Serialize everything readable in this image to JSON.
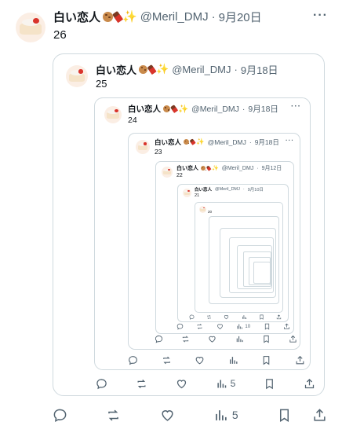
{
  "author": {
    "display_name": "白い恋人",
    "handle": "@Meril_DMJ",
    "emoji_icons": [
      "cookie-icon",
      "chocolate-icon",
      "sparkles-icon"
    ]
  },
  "main_post": {
    "date": "9月20日",
    "text": "26",
    "views": "5"
  },
  "quote_1": {
    "date": "9月18日",
    "text": "25",
    "views": "5"
  },
  "quote_2": {
    "date": "9月18日",
    "text": "24"
  },
  "quote_3": {
    "date": "9月18日",
    "text": "23"
  },
  "quote_4": {
    "date": "9月12日",
    "text": "22",
    "views": "10"
  },
  "quote_5": {
    "date": "9月10日",
    "text": "21"
  },
  "quote_6": {
    "date": "",
    "text": "20"
  },
  "more_label": "···",
  "separator": "·"
}
